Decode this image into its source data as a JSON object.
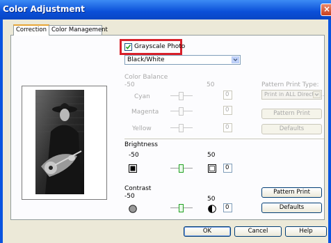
{
  "window": {
    "title": "Color Adjustment",
    "close_glyph": "×"
  },
  "tabs": [
    {
      "label": "Correction"
    },
    {
      "label": "Color Management"
    }
  ],
  "grayscale": {
    "label": "Grayscale Photo",
    "checked": true,
    "mode_value": "Black/White"
  },
  "color_balance": {
    "heading": "Color Balance",
    "min_label": "-50",
    "max_label": "50",
    "rows": [
      {
        "label": "Cyan",
        "value": "0"
      },
      {
        "label": "Magenta",
        "value": "0"
      },
      {
        "label": "Yellow",
        "value": "0"
      }
    ]
  },
  "pattern_type": {
    "label": "Pattern Print Type:",
    "value": "Print in ALL Directio..."
  },
  "color_buttons": {
    "pattern_print": "Pattern Print",
    "defaults": "Defaults"
  },
  "brightness": {
    "heading": "Brightness",
    "min_label": "-50",
    "max_label": "50",
    "value": "0"
  },
  "contrast": {
    "heading": "Contrast",
    "min_label": "-50",
    "max_label": "50",
    "value": "0"
  },
  "tone_buttons": {
    "pattern_print": "Pattern Print",
    "defaults": "Defaults"
  },
  "footer": {
    "ok": "OK",
    "cancel": "Cancel",
    "help": "Help"
  },
  "colors": {
    "title_bar": "#0a54e0",
    "dialog_face": "#ece9d8",
    "highlight_box": "#d8202a",
    "slider_active": "#21a121"
  },
  "icons": {
    "brightness_low": "square-dark-icon",
    "brightness_high": "square-light-icon",
    "contrast_low": "circle-grey-icon",
    "contrast_high": "circle-half-icon"
  }
}
